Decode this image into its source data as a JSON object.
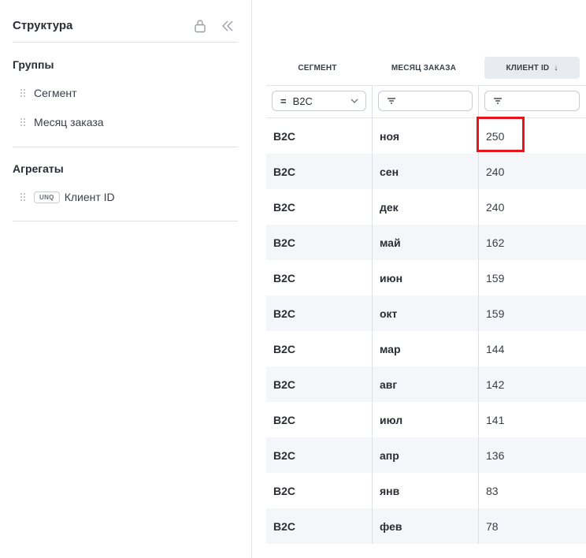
{
  "sidebar": {
    "title": "Структура",
    "groups_title": "Группы",
    "groups": [
      "Сегмент",
      "Месяц заказа"
    ],
    "aggregates_title": "Агрегаты",
    "aggregates": [
      {
        "badge": "UNQ",
        "label": "Клиент ID"
      }
    ]
  },
  "table": {
    "columns": [
      "СЕГМЕНТ",
      "МЕСЯЦ ЗАКАЗА",
      "КЛИЕНТ ID"
    ],
    "sort_arrow": "↓",
    "filters": {
      "segment_op": "=",
      "segment_value": "B2C",
      "month_value": "",
      "client_value": ""
    },
    "rows": [
      {
        "segment": "B2C",
        "month": "ноя",
        "client": "250"
      },
      {
        "segment": "B2C",
        "month": "сен",
        "client": "240"
      },
      {
        "segment": "B2C",
        "month": "дек",
        "client": "240"
      },
      {
        "segment": "B2C",
        "month": "май",
        "client": "162"
      },
      {
        "segment": "B2C",
        "month": "июн",
        "client": "159"
      },
      {
        "segment": "B2C",
        "month": "окт",
        "client": "159"
      },
      {
        "segment": "B2C",
        "month": "мар",
        "client": "144"
      },
      {
        "segment": "B2C",
        "month": "авг",
        "client": "142"
      },
      {
        "segment": "B2C",
        "month": "июл",
        "client": "141"
      },
      {
        "segment": "B2C",
        "month": "апр",
        "client": "136"
      },
      {
        "segment": "B2C",
        "month": "янв",
        "client": "83"
      },
      {
        "segment": "B2C",
        "month": "фев",
        "client": "78"
      }
    ]
  },
  "colors": {
    "highlight": "#e8141c",
    "row_alt": "#f5f6f9",
    "header_active": "#e8ebf0"
  }
}
